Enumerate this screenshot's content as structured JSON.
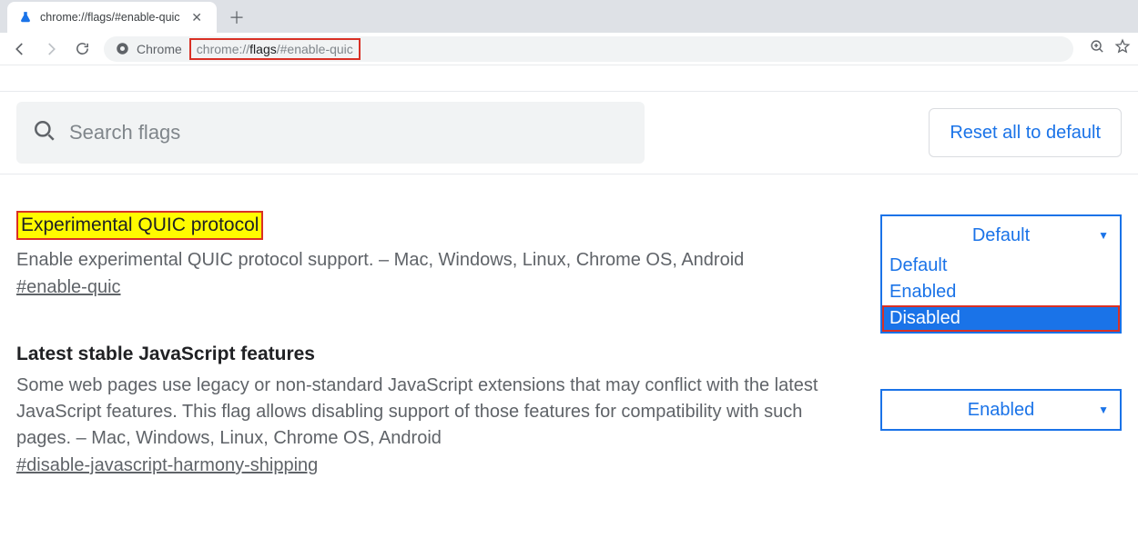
{
  "tab": {
    "title": "chrome://flags/#enable-quic"
  },
  "omnibox": {
    "source_label": "Chrome",
    "url_prefix": "chrome://",
    "url_host": "flags",
    "url_suffix": "/#enable-quic"
  },
  "search": {
    "placeholder": "Search flags"
  },
  "reset_button_label": "Reset all to default",
  "flags": [
    {
      "title": "Experimental QUIC protocol",
      "desc": "Enable experimental QUIC protocol support. – Mac, Windows, Linux, Chrome OS, Android",
      "anchor": "#enable-quic",
      "selected": "Default",
      "options": [
        "Default",
        "Enabled",
        "Disabled"
      ],
      "highlighted_option": "Disabled",
      "open": true,
      "title_highlighted": true
    },
    {
      "title": "Latest stable JavaScript features",
      "desc": "Some web pages use legacy or non-standard JavaScript extensions that may conflict with the latest JavaScript features. This flag allows disabling support of those features for compatibility with such pages. – Mac, Windows, Linux, Chrome OS, Android",
      "anchor": "#disable-javascript-harmony-shipping",
      "selected": "Enabled",
      "open": false,
      "title_highlighted": false
    }
  ]
}
